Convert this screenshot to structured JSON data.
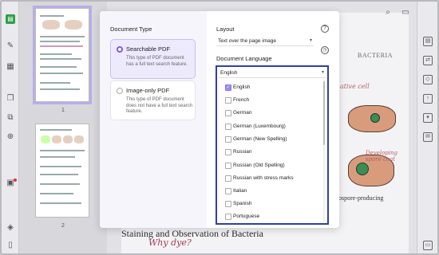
{
  "dialog": {
    "document_type_label": "Document Type",
    "options": [
      {
        "title": "Searchable PDF",
        "desc": "This type of PDF document has a full text search feature.",
        "selected": true
      },
      {
        "title": "Image-only PDF",
        "desc": "This type of PDF document does not have a full text search feature.",
        "selected": false
      }
    ],
    "layout_label": "Layout",
    "layout_value": "Text over the page image",
    "language_label": "Document Language",
    "language_value": "English",
    "languages": [
      {
        "label": "English",
        "checked": true
      },
      {
        "label": "French",
        "checked": false
      },
      {
        "label": "German",
        "checked": false
      },
      {
        "label": "German (Luxembourg)",
        "checked": false
      },
      {
        "label": "German (New Spelling)",
        "checked": false
      },
      {
        "label": "Russian",
        "checked": false
      },
      {
        "label": "Russian (Old Spelling)",
        "checked": false
      },
      {
        "label": "Russian with stress marks",
        "checked": false
      },
      {
        "label": "Italian",
        "checked": false
      },
      {
        "label": "Spanish",
        "checked": false
      },
      {
        "label": "Portuguese",
        "checked": false
      }
    ]
  },
  "thumbnails": {
    "page1": "1",
    "page2": "2"
  },
  "document": {
    "header": "BACTERIA",
    "hand_1": "ative cell",
    "hand_2": "Developing spore coat",
    "hand_3": "ospore-producing",
    "hand_4": "Why dye?",
    "heading": "Staining and Observation of Bacteria"
  },
  "colors": {
    "accent": "#7c5ce0",
    "highlight_border": "#2f3fa8",
    "checkbox_on": "#9b87f5"
  }
}
